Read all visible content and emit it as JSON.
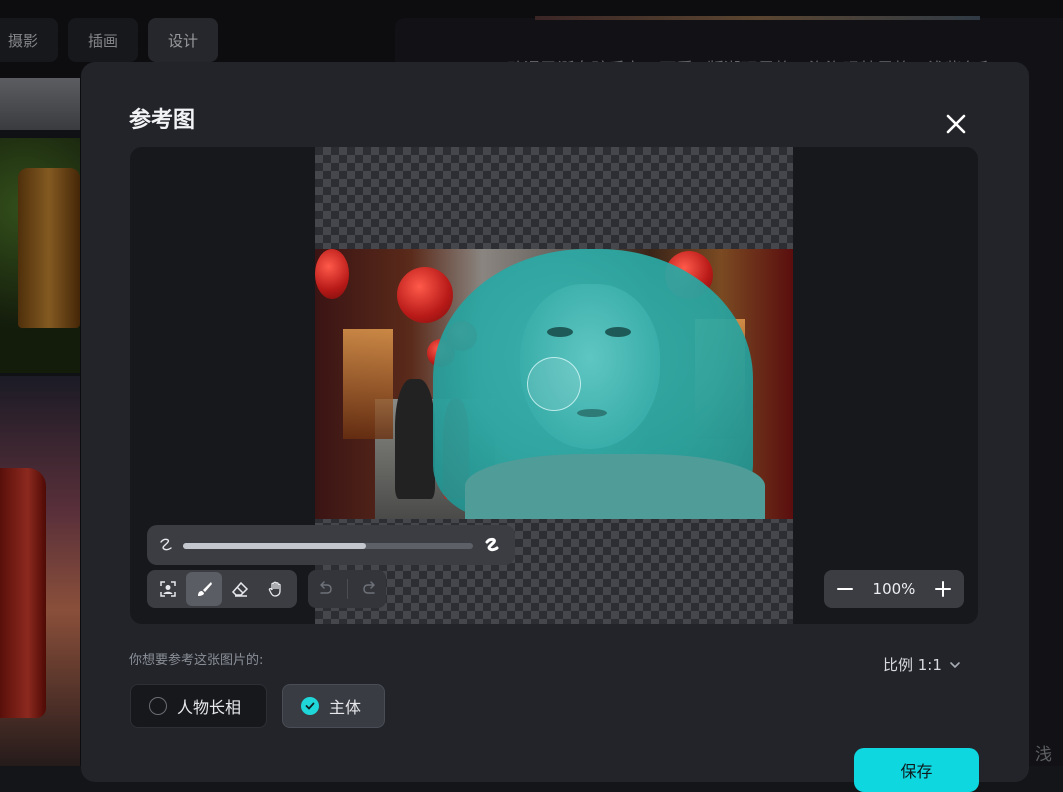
{
  "background": {
    "tabs": [
      {
        "label": "摄影"
      },
      {
        "label": "插画"
      },
      {
        "label": "设计",
        "active": true
      }
    ],
    "right_text": "23:34   动漫圣诞女孩手办，可爱Q版潮玩风格，泡泡玛特风格，浅紫色和",
    "right_tail": "、浅"
  },
  "modal": {
    "title": "参考图",
    "close_icon": "close-icon",
    "brush_size": {
      "value": 0.63,
      "min_icon": "brush-thin-icon",
      "max_icon": "brush-thick-icon"
    },
    "tools": [
      {
        "name": "subject-select-icon",
        "active": false
      },
      {
        "name": "brush-icon",
        "active": true
      },
      {
        "name": "eraser-icon",
        "active": false
      },
      {
        "name": "hand-icon",
        "active": false
      }
    ],
    "history": [
      {
        "name": "undo-icon"
      },
      {
        "name": "redo-icon"
      }
    ],
    "zoom": {
      "minus": "−",
      "value": "100%",
      "plus": "+"
    },
    "question": "你想要参考这张图片的:",
    "ratio_label": "比例 1:1",
    "options": [
      {
        "label": "人物长相",
        "selected": false
      },
      {
        "label": "主体",
        "selected": true
      }
    ],
    "save_label": "保存",
    "accent_color": "#0fd7e0"
  }
}
